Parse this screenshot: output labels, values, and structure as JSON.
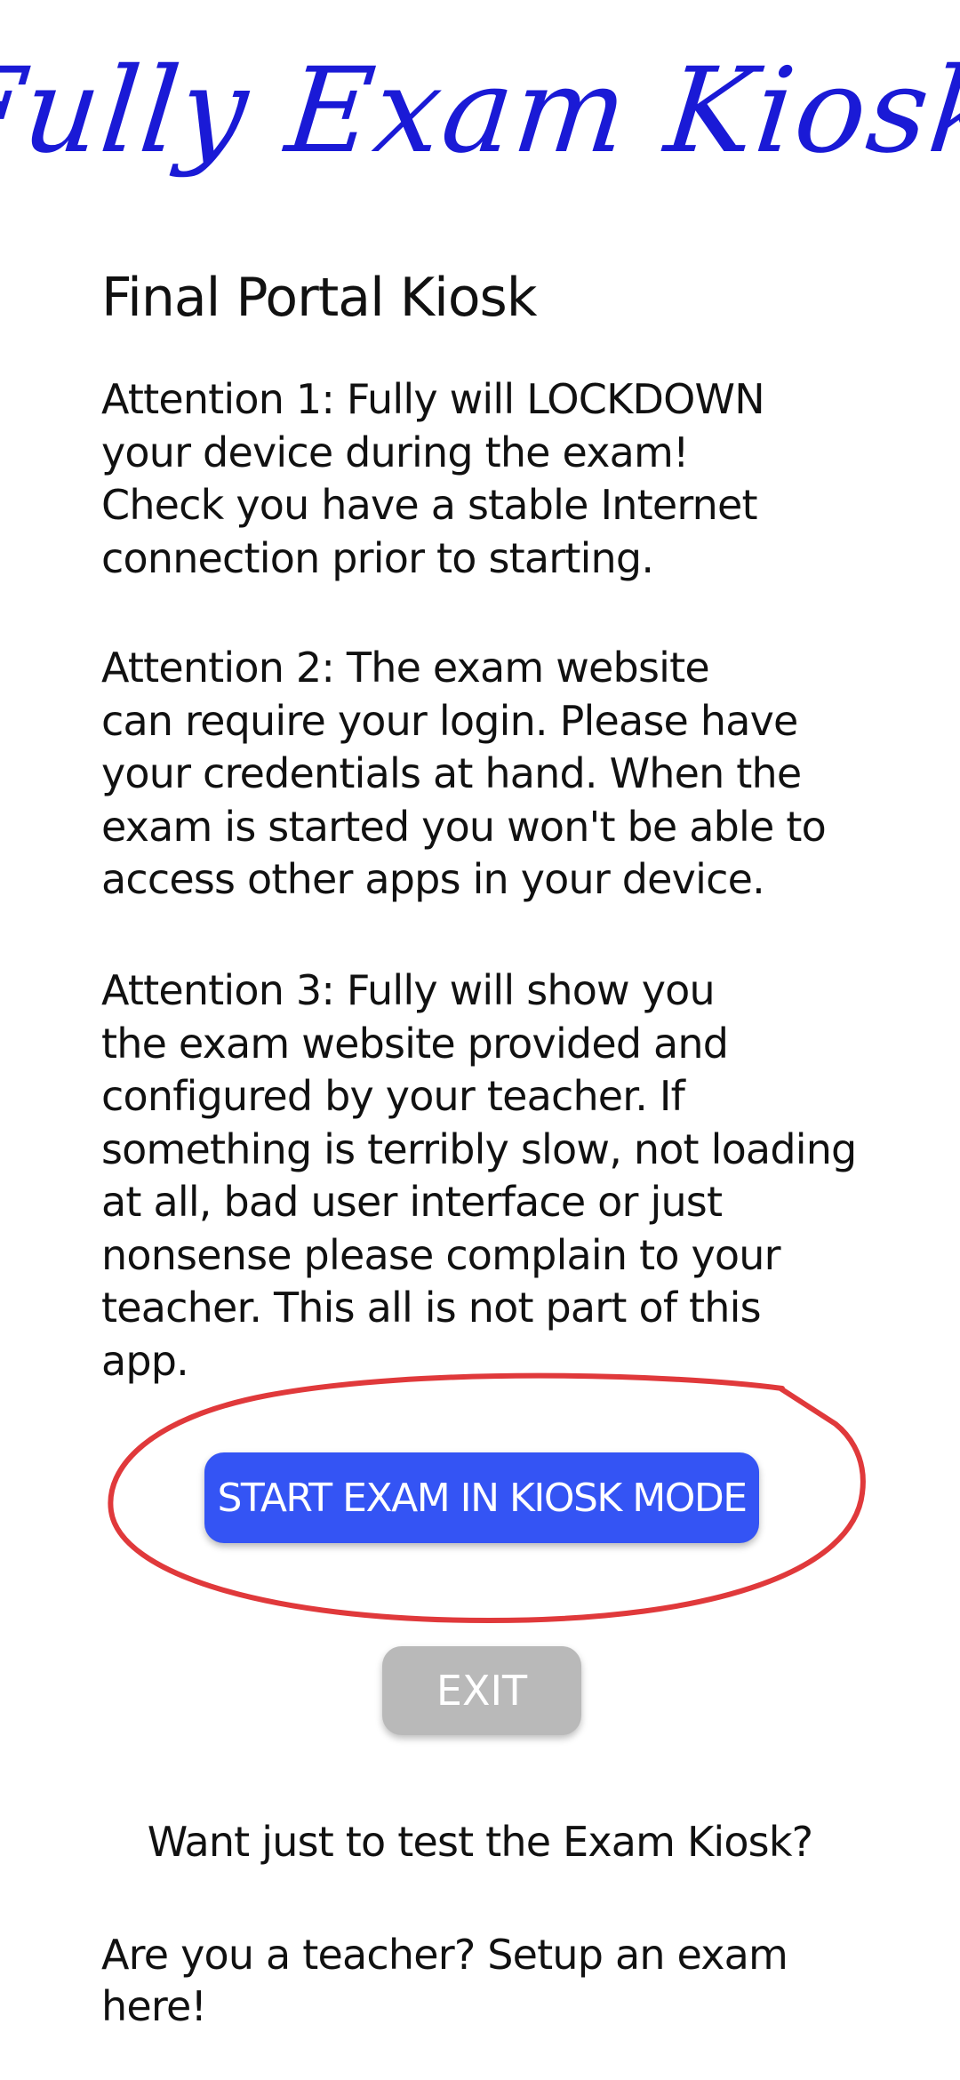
{
  "app": {
    "logo_text": "Fully Exam Kiosk"
  },
  "page": {
    "title": "Final Portal Kiosk",
    "attention_1": "Attention 1: Fully will LOCKDOWN\nyour device during the exam!\nCheck you have a stable Internet\nconnection prior to starting.",
    "attention_2": "Attention 2: The exam website\ncan require your login. Please have\nyour credentials at hand. When the\nexam is started you won't be able to\naccess other apps in your device.",
    "attention_3": "Attention 3: Fully will show you\nthe exam website provided and\nconfigured by your teacher. If\nsomething is terribly slow, not loading\nat all, bad user interface or just\nnonsense please complain to your\nteacher. This all is not part of this\napp."
  },
  "buttons": {
    "start_label": "START EXAM IN KIOSK MODE",
    "exit_label": "EXIT"
  },
  "links": {
    "test_label": "Want just to test the Exam Kiosk?",
    "teacher_label": "Are you a teacher? Setup an exam here!"
  },
  "colors": {
    "logo": "#1a1ad6",
    "start_button": "#3454f4",
    "exit_button": "#b9b9b9",
    "annotation": "#e0393b"
  },
  "icons": {
    "annotation": "hand-drawn-circle-annotation"
  }
}
